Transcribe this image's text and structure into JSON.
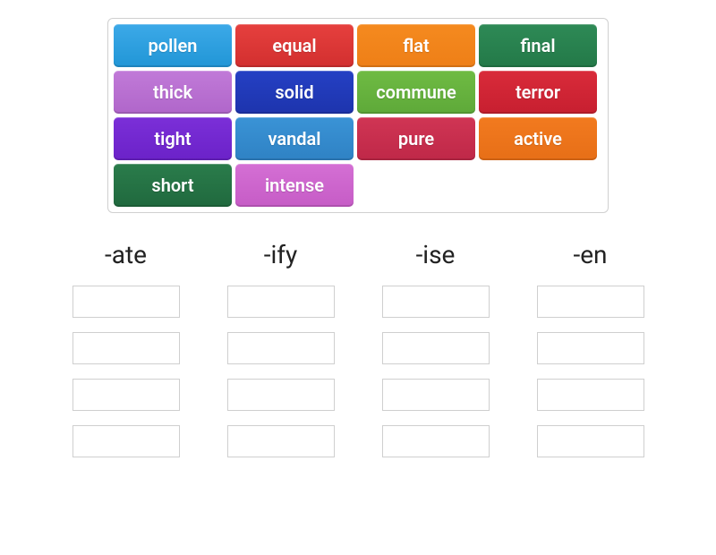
{
  "word_bank": [
    {
      "label": "pollen",
      "color": "c-blue"
    },
    {
      "label": "equal",
      "color": "c-red"
    },
    {
      "label": "flat",
      "color": "c-orange"
    },
    {
      "label": "final",
      "color": "c-green"
    },
    {
      "label": "thick",
      "color": "c-lilac"
    },
    {
      "label": "solid",
      "color": "c-navy"
    },
    {
      "label": "commune",
      "color": "c-limegrn"
    },
    {
      "label": "terror",
      "color": "c-crimson"
    },
    {
      "label": "tight",
      "color": "c-violet"
    },
    {
      "label": "vandal",
      "color": "c-skyblue"
    },
    {
      "label": "pure",
      "color": "c-magenta"
    },
    {
      "label": "active",
      "color": "c-orange2"
    },
    {
      "label": "short",
      "color": "c-darkgrn"
    },
    {
      "label": "intense",
      "color": "c-pink"
    }
  ],
  "columns": [
    {
      "header": "-ate",
      "slots": 4
    },
    {
      "header": "-ify",
      "slots": 4
    },
    {
      "header": "-ise",
      "slots": 4
    },
    {
      "header": "-en",
      "slots": 4
    }
  ]
}
